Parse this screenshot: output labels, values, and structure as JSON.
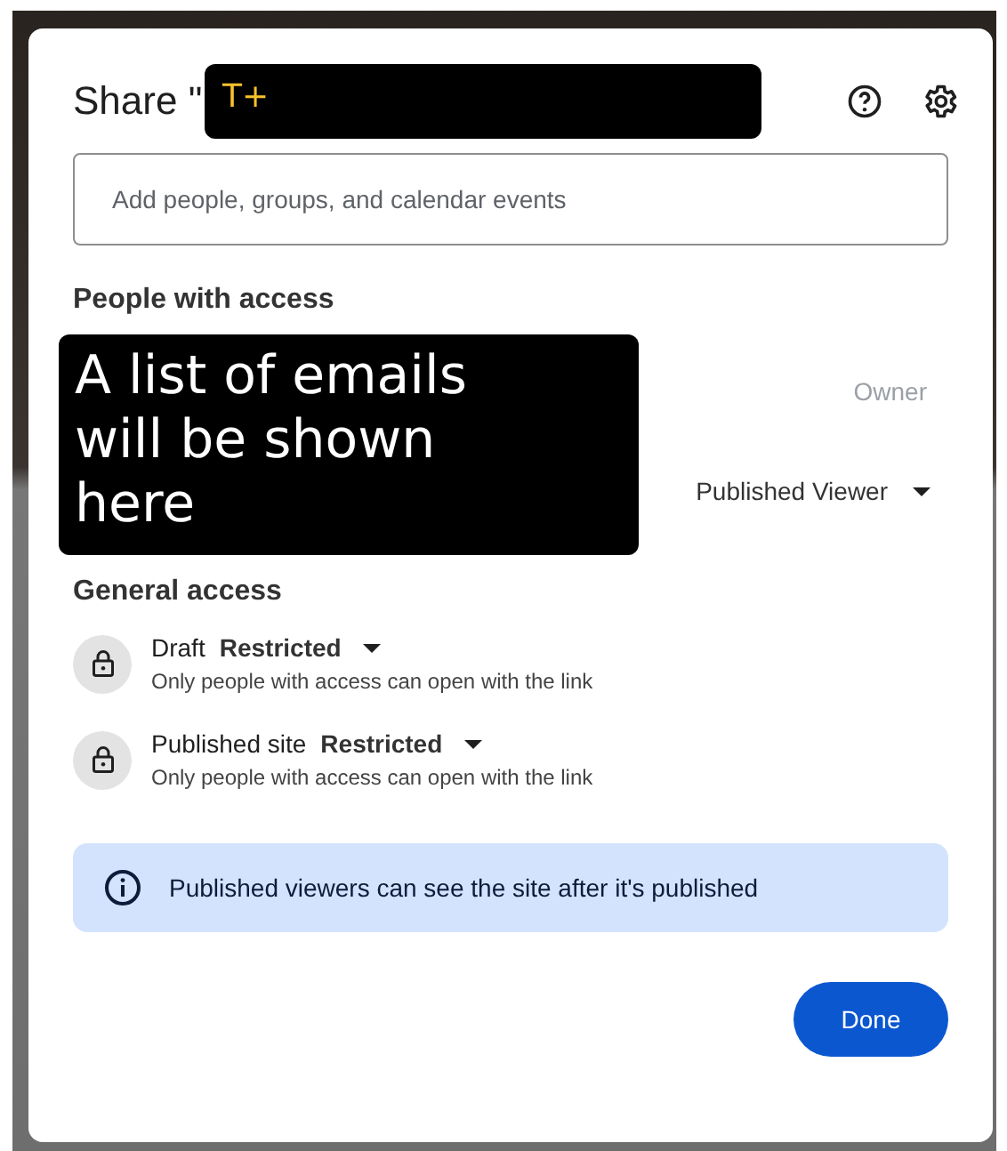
{
  "dialog": {
    "title": "Share \"",
    "title_redaction": "T+"
  },
  "search": {
    "placeholder": "Add people, groups, and calendar events"
  },
  "people": {
    "heading": "People with access",
    "redaction": "A list of emails will be shown here",
    "roles": [
      {
        "label": "Owner",
        "kind": "static"
      },
      {
        "label": "Published Viewer",
        "kind": "dropdown"
      }
    ]
  },
  "general_access": {
    "heading": "General access",
    "items": [
      {
        "label": "Draft",
        "value": "Restricted",
        "description": "Only people with access can open with the link"
      },
      {
        "label": "Published site",
        "value": "Restricted",
        "description": "Only people with access can open with the link"
      }
    ]
  },
  "banner": {
    "text": "Published viewers can see the site after it's published"
  },
  "buttons": [
    {
      "label": "Done"
    }
  ]
}
